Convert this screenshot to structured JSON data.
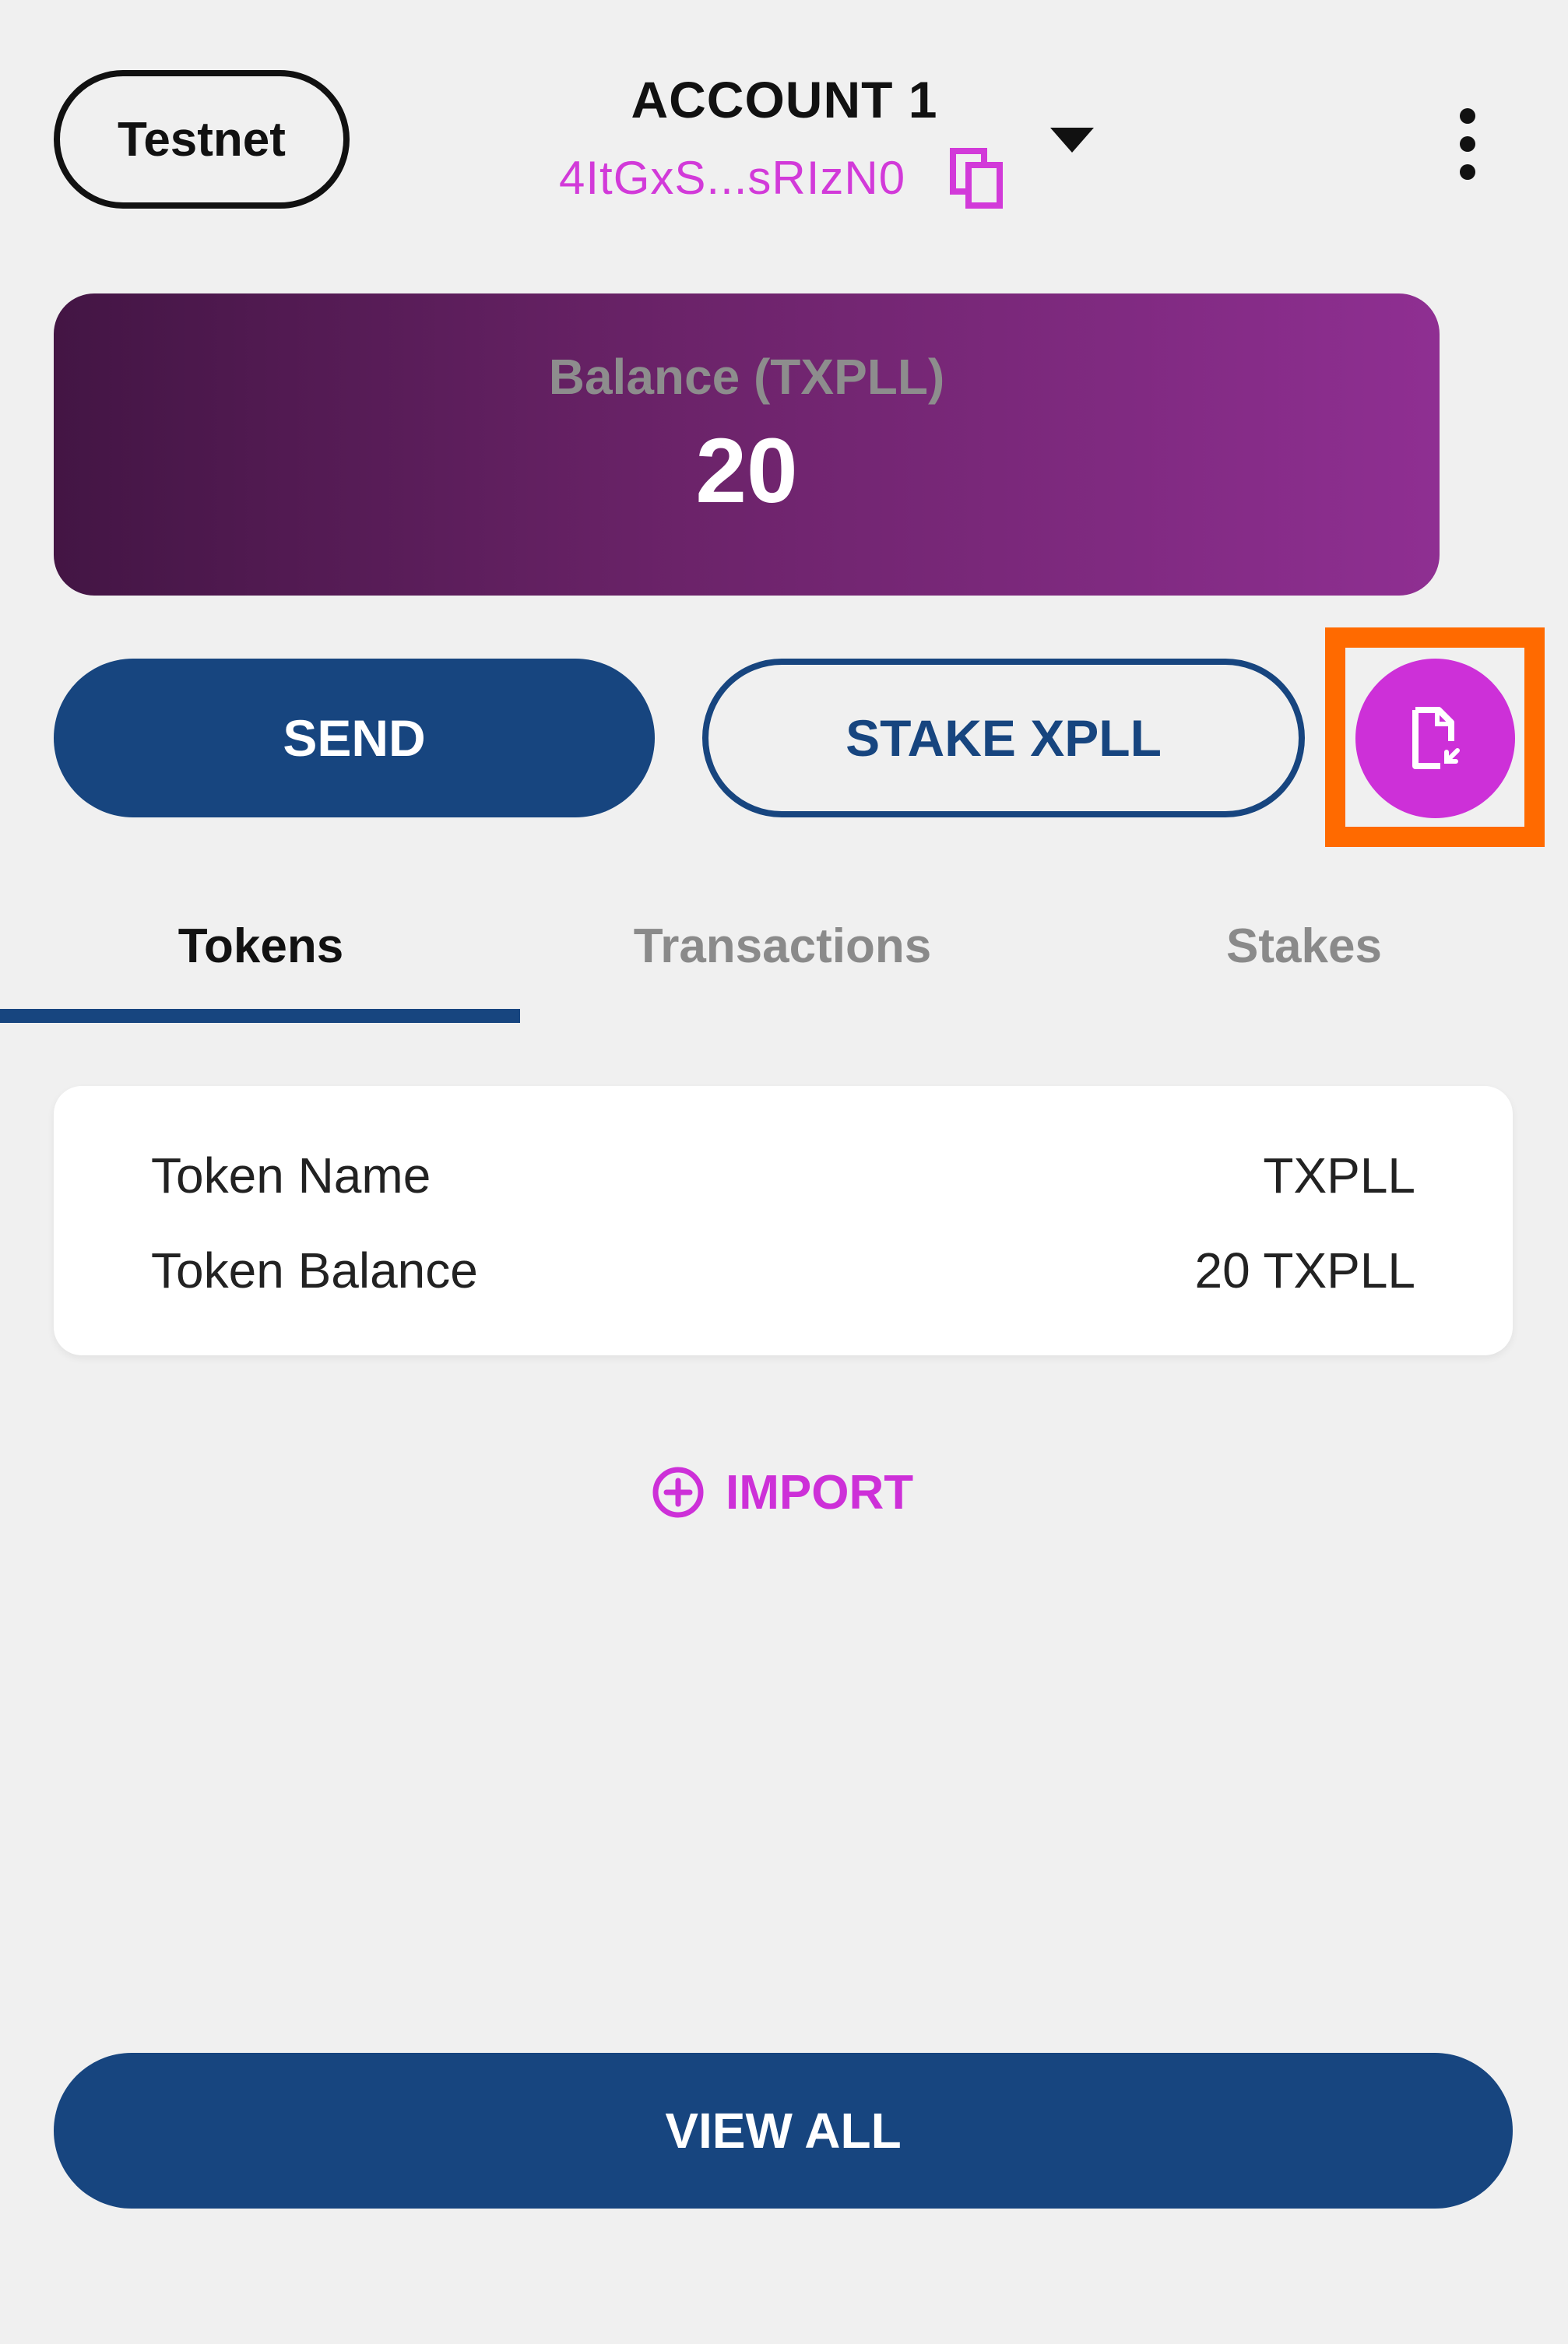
{
  "header": {
    "network_label": "Testnet",
    "account_name": "ACCOUNT 1",
    "account_address": "4ItGxS...sRIzN0"
  },
  "icons": {
    "copy": "copy-icon",
    "dropdown": "chevron-down-icon",
    "menu": "more-vertical-icon",
    "receive": "document-receive-icon",
    "import": "plus-circle-icon"
  },
  "balance": {
    "label": "Balance (TXPLL)",
    "value": "20"
  },
  "actions": {
    "send_label": "SEND",
    "stake_label": "STAKE XPLL"
  },
  "tabs": [
    {
      "label": "Tokens",
      "active": true
    },
    {
      "label": "Transactions",
      "active": false
    },
    {
      "label": "Stakes",
      "active": false
    }
  ],
  "token": {
    "name_label": "Token Name",
    "name_value": "TXPLL",
    "balance_label": "Token Balance",
    "balance_value": "20 TXPLL"
  },
  "import_label": "IMPORT",
  "view_all_label": "VIEW ALL",
  "colors": {
    "primary": "#17457f",
    "accent": "#cd30d8",
    "highlight": "#ff6a00",
    "background": "#f0f0f0"
  }
}
